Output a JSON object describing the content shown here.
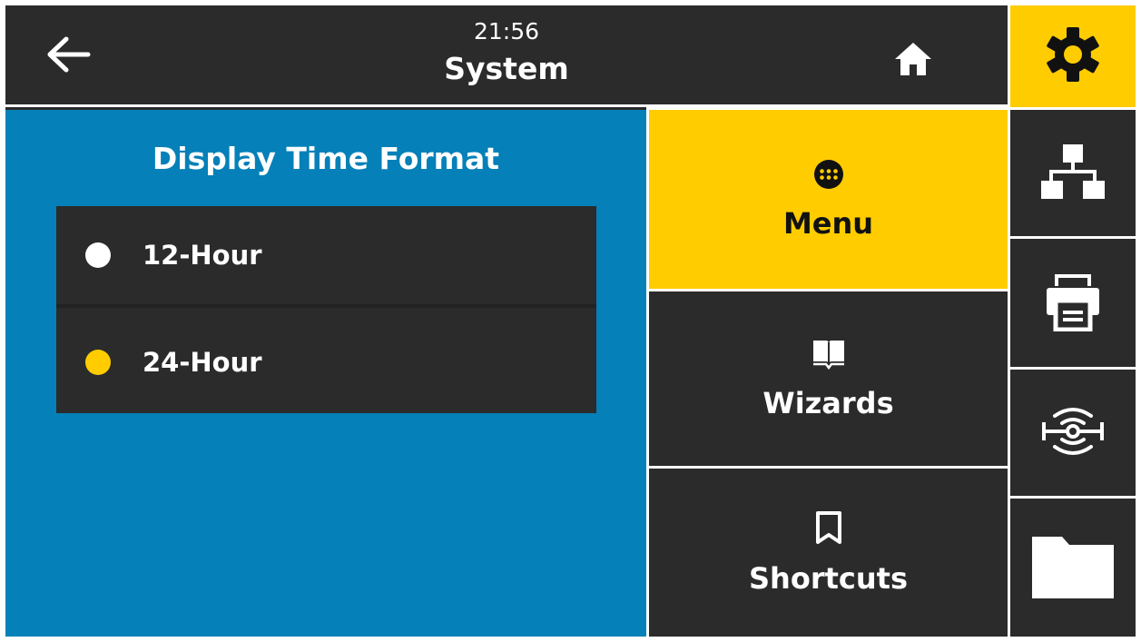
{
  "header": {
    "time": "21:56",
    "title": "System",
    "back_icon": "arrow-left-icon",
    "home_icon": "home-icon"
  },
  "setting": {
    "heading": "Display Time Format",
    "options": [
      {
        "label": "12-Hour",
        "selected": false
      },
      {
        "label": "24-Hour",
        "selected": true
      }
    ]
  },
  "menu": {
    "items": [
      {
        "label": "Menu",
        "icon": "grid-dots-icon",
        "active": true
      },
      {
        "label": "Wizards",
        "icon": "book-icon",
        "active": false
      },
      {
        "label": "Shortcuts",
        "icon": "bookmark-icon",
        "active": false
      }
    ]
  },
  "rail": {
    "items": [
      {
        "icon": "gear-icon",
        "active": true
      },
      {
        "icon": "network-icon",
        "active": false
      },
      {
        "icon": "printer-icon",
        "active": false
      },
      {
        "icon": "rfid-icon",
        "active": false
      },
      {
        "icon": "folder-icon",
        "active": false
      }
    ]
  },
  "colors": {
    "accent_yellow": "#ffcc00",
    "content_blue": "#0580b8",
    "dark_panel": "#2b2b2b",
    "text_white": "#ffffff",
    "radio_unselected": "#ffffff",
    "radio_selected": "#ffcc00"
  }
}
